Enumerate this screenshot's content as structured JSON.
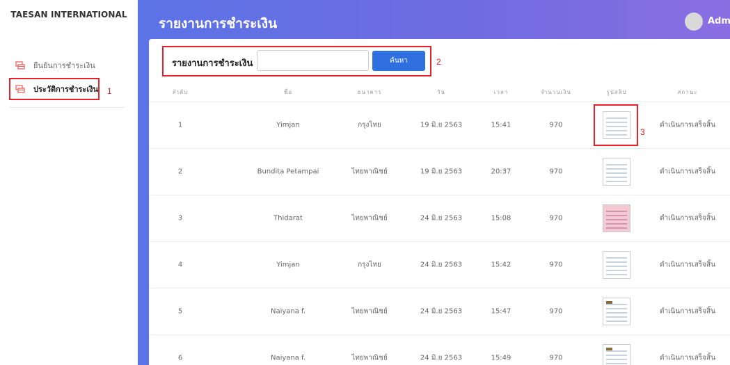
{
  "sidebar": {
    "brand": "TAESAN INTERNATIONAL",
    "items": [
      {
        "label": "ยืนยันการชำระเงิน"
      },
      {
        "label": "ประวัติการชำระเงิน"
      }
    ]
  },
  "header": {
    "title": "รายงานการชำระเงิน",
    "user": "Admin"
  },
  "search": {
    "label": "รายงานการชำระเงิน",
    "value": "",
    "button": "ค้นหา"
  },
  "annotations": [
    "1",
    "2",
    "3"
  ],
  "table": {
    "headers": [
      "ลำดับ",
      "ชื่อ",
      "ธนาคาร",
      "วัน",
      "เวลา",
      "จำนวนเงิน",
      "รูปสลิป",
      "สถานะ"
    ],
    "rows": [
      {
        "no": "1",
        "name": "Yimjan",
        "bank": "กรุงไทย",
        "date": "19 มิ.ย 2563",
        "time": "15:41",
        "amount": "970",
        "slip": "slip-icon",
        "status": "ดำเนินการเสร็จสิ้น"
      },
      {
        "no": "2",
        "name": "Bundita Petampai",
        "bank": "ไทยพาณิชย์",
        "date": "19 มิ.ย 2563",
        "time": "20:37",
        "amount": "970",
        "slip": "slip-icon",
        "status": "ดำเนินการเสร็จสิ้น"
      },
      {
        "no": "3",
        "name": "Thidarat",
        "bank": "ไทยพาณิชย์",
        "date": "24 มิ.ย 2563",
        "time": "15:08",
        "amount": "970",
        "slip": "slip-icon",
        "status": "ดำเนินการเสร็จสิ้น"
      },
      {
        "no": "4",
        "name": "Yimjan",
        "bank": "กรุงไทย",
        "date": "24 มิ.ย 2563",
        "time": "15:42",
        "amount": "970",
        "slip": "slip-icon",
        "status": "ดำเนินการเสร็จสิ้น"
      },
      {
        "no": "5",
        "name": "Naiyana f.",
        "bank": "ไทยพาณิชย์",
        "date": "24 มิ.ย 2563",
        "time": "15:47",
        "amount": "970",
        "slip": "slip-icon",
        "status": "ดำเนินการเสร็จสิ้น"
      },
      {
        "no": "6",
        "name": "Naiyana f.",
        "bank": "ไทยพาณิชย์",
        "date": "24 มิ.ย 2563",
        "time": "15:49",
        "amount": "970",
        "slip": "slip-icon",
        "status": "ดำเนินการเสร็จสิ้น"
      }
    ]
  },
  "colors": {
    "header_start": "#5b73e6",
    "header_end": "#8a6fe3",
    "button": "#2f6fe0",
    "annotation": "#e8202a"
  }
}
